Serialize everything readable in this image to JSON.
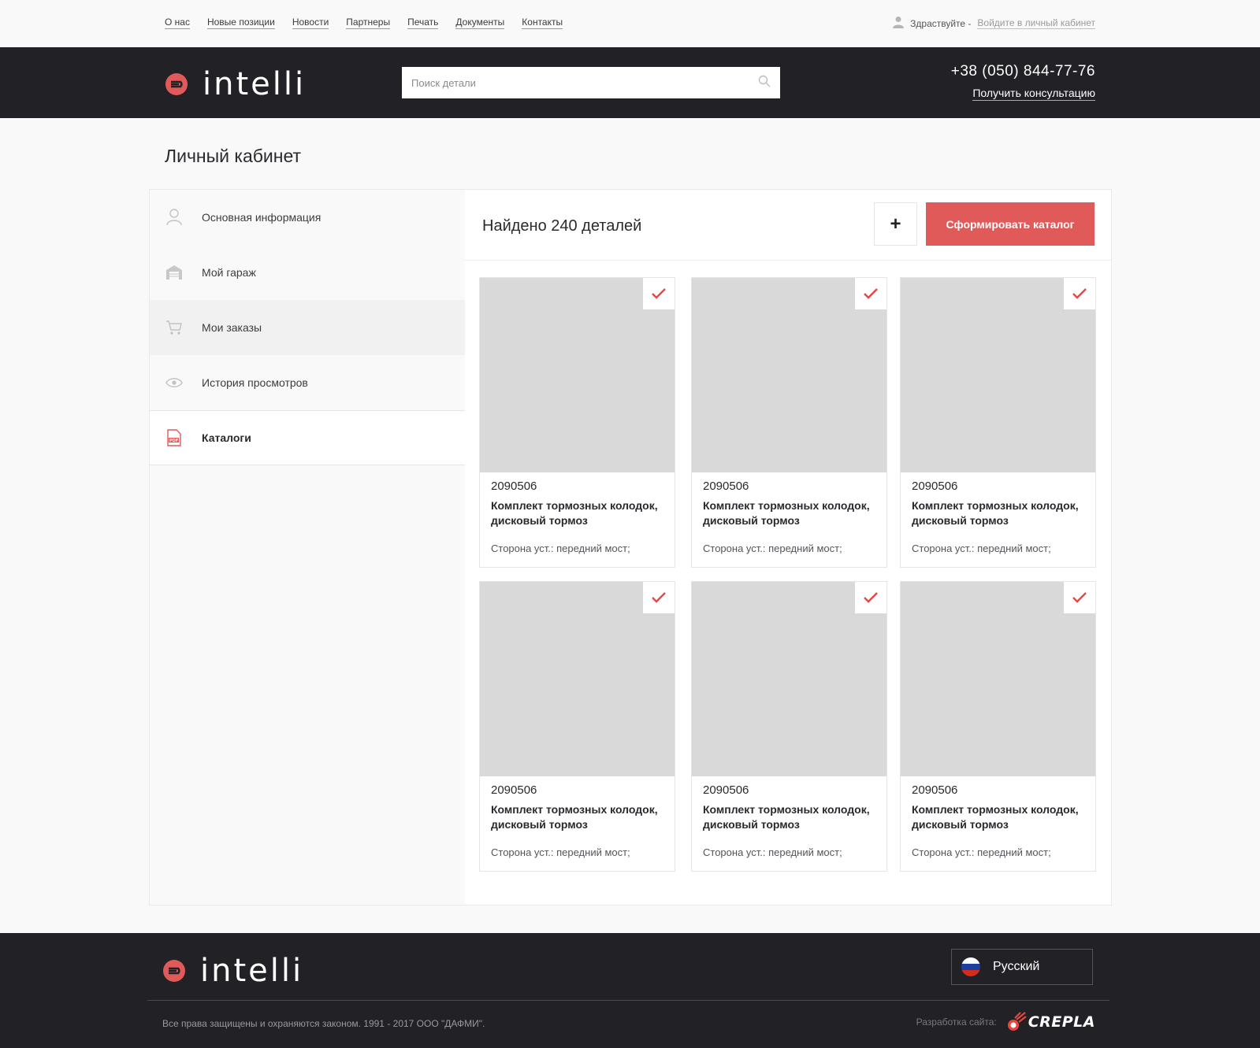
{
  "topnav": {
    "links": [
      "О нас",
      "Новые позиции",
      "Новости",
      "Партнеры",
      "Печать",
      "Документы",
      "Контакты"
    ],
    "greeting": "Здраствуйте -",
    "login_link": "Войдите в личный кабинет"
  },
  "header": {
    "logo_text": "intelli",
    "search_placeholder": "Поиск детали",
    "phone": "+38 (050) 844-77-76",
    "consult_link": "Получить консультацию"
  },
  "page_title": "Личный кабинет",
  "sidebar": {
    "items": [
      {
        "label": "Основная информация",
        "icon": "user-icon"
      },
      {
        "label": "Мой гараж",
        "icon": "garage-icon"
      },
      {
        "label": "Мои заказы",
        "icon": "cart-icon"
      },
      {
        "label": "История просмотров",
        "icon": "eye-icon"
      },
      {
        "label": "Каталоги",
        "icon": "pdf-icon"
      }
    ]
  },
  "content": {
    "found_text": "Найдено 240 деталей",
    "add_button": "+",
    "make_catalog_button": "Сформировать каталог",
    "cards": [
      {
        "code": "2090506",
        "name": "Комплект тормозных колодок, дисковый тормоз",
        "prop": "Сторона уст.: передний мост;",
        "checked": true
      },
      {
        "code": "2090506",
        "name": "Комплект тормозных колодок, дисковый тормоз",
        "prop": "Сторона уст.: передний мост;",
        "checked": true
      },
      {
        "code": "2090506",
        "name": "Комплект тормозных колодок, дисковый тормоз",
        "prop": "Сторона уст.: передний мост;",
        "checked": true
      },
      {
        "code": "2090506",
        "name": "Комплект тормозных колодок, дисковый тормоз",
        "prop": "Сторона уст.: передний мост;",
        "checked": true
      },
      {
        "code": "2090506",
        "name": "Комплект тормозных колодок, дисковый тормоз",
        "prop": "Сторона уст.: передний мост;",
        "checked": true
      },
      {
        "code": "2090506",
        "name": "Комплект тормозных колодок, дисковый тормоз",
        "prop": "Сторона уст.: передний мост;",
        "checked": true
      }
    ]
  },
  "footer": {
    "logo_text": "intelli",
    "language": "Русский",
    "copyright": "Все права защищены и охраняются законом. 1991 - 2017 ООО \"ДАФМИ\".",
    "dev_label": "Разработка сайта:",
    "dev_logo": "CREPLA"
  },
  "colors": {
    "accent": "#e05a5a",
    "dark": "#222226",
    "placeholder": "#d9d9d9"
  }
}
